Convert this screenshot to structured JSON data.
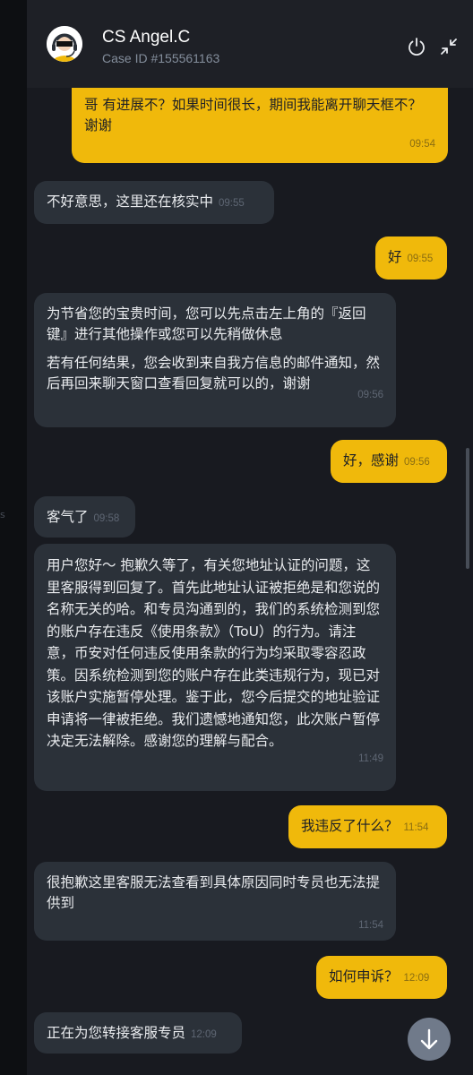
{
  "header": {
    "agent_name": "CS Angel.C",
    "case_id": "Case ID #155561163",
    "icons": [
      "power-icon",
      "collapse-icon"
    ]
  },
  "messages": [
    {
      "from": "user",
      "text": "哥 有进展不？如果时间很长，期间我能离开聊天框不？谢谢",
      "time": "09:54"
    },
    {
      "from": "agent",
      "text": "不好意思，这里还在核实中",
      "time": "09:55"
    },
    {
      "from": "user",
      "text": "好",
      "time": "09:55"
    },
    {
      "from": "agent",
      "paragraphs": [
        "为节省您的宝贵时间，您可以先点击左上角的『返回键』进行其他操作或您可以先稍做休息",
        "若有任何结果，您会收到来自我方信息的邮件通知，然后再回来聊天窗口查看回复就可以的，谢谢"
      ],
      "time": "09:56"
    },
    {
      "from": "user",
      "text": "好，感谢",
      "time": "09:56"
    },
    {
      "from": "agent",
      "text": "客气了",
      "time": "09:58"
    },
    {
      "from": "agent",
      "text": "用户您好～ 抱歉久等了，有关您地址认证的问题，这里客服得到回复了。首先此地址认证被拒绝是和您说的名称无关的哈。和专员沟通到的，我们的系统检测到您的账户存在违反《使用条款》（ToU）的行为。请注意，币安对任何违反使用条款的行为均采取零容忍政策。因系统检测到您的账户存在此类违规行为，现已对该账户实施暂停处理。鉴于此，您今后提交的地址验证申请将一律被拒绝。我们遗憾地通知您，此次账户暂停决定无法解除。感谢您的理解与配合。",
      "time": "11:49"
    },
    {
      "from": "user",
      "text": "我违反了什么？",
      "time": "11:54"
    },
    {
      "from": "agent",
      "text": "很抱歉这里客服无法查看到具体原因同时专员也无法提供到",
      "time": "11:54"
    },
    {
      "from": "user",
      "text": "如何申诉？",
      "time": "12:09"
    },
    {
      "from": "agent",
      "text": "正在为您转接客服专员",
      "time": "12:09"
    }
  ],
  "controls": {
    "scroll_down_icon": "arrow-down-icon"
  },
  "colors": {
    "user_bubble": "#f0b90b",
    "agent_bubble": "#2b3139",
    "background": "#181a20"
  }
}
